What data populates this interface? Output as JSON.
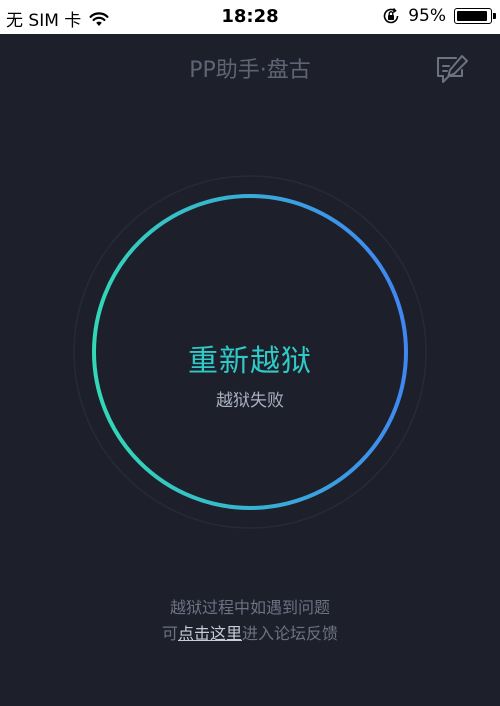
{
  "status_bar": {
    "carrier": "无 SIM 卡",
    "time": "18:28",
    "battery_percent_text": "95%",
    "battery_level": 0.95,
    "icons": [
      "wifi-icon",
      "orientation-lock-icon",
      "battery-icon"
    ]
  },
  "nav": {
    "title": "PP助手·盘古",
    "right_icon": "feedback-edit-icon"
  },
  "main": {
    "button_label": "重新越狱",
    "status_text": "越狱失败"
  },
  "footer": {
    "line1": "越狱过程中如遇到问题",
    "prefix": "可",
    "link_text": "点击这里",
    "suffix": "进入论坛反馈"
  },
  "colors": {
    "background": "#1d1f2b",
    "ring_gradient_start": "#32d8b5",
    "ring_gradient_end": "#3f86f3",
    "title_accent": "#2fc9c7",
    "muted_text": "#6c7282"
  }
}
